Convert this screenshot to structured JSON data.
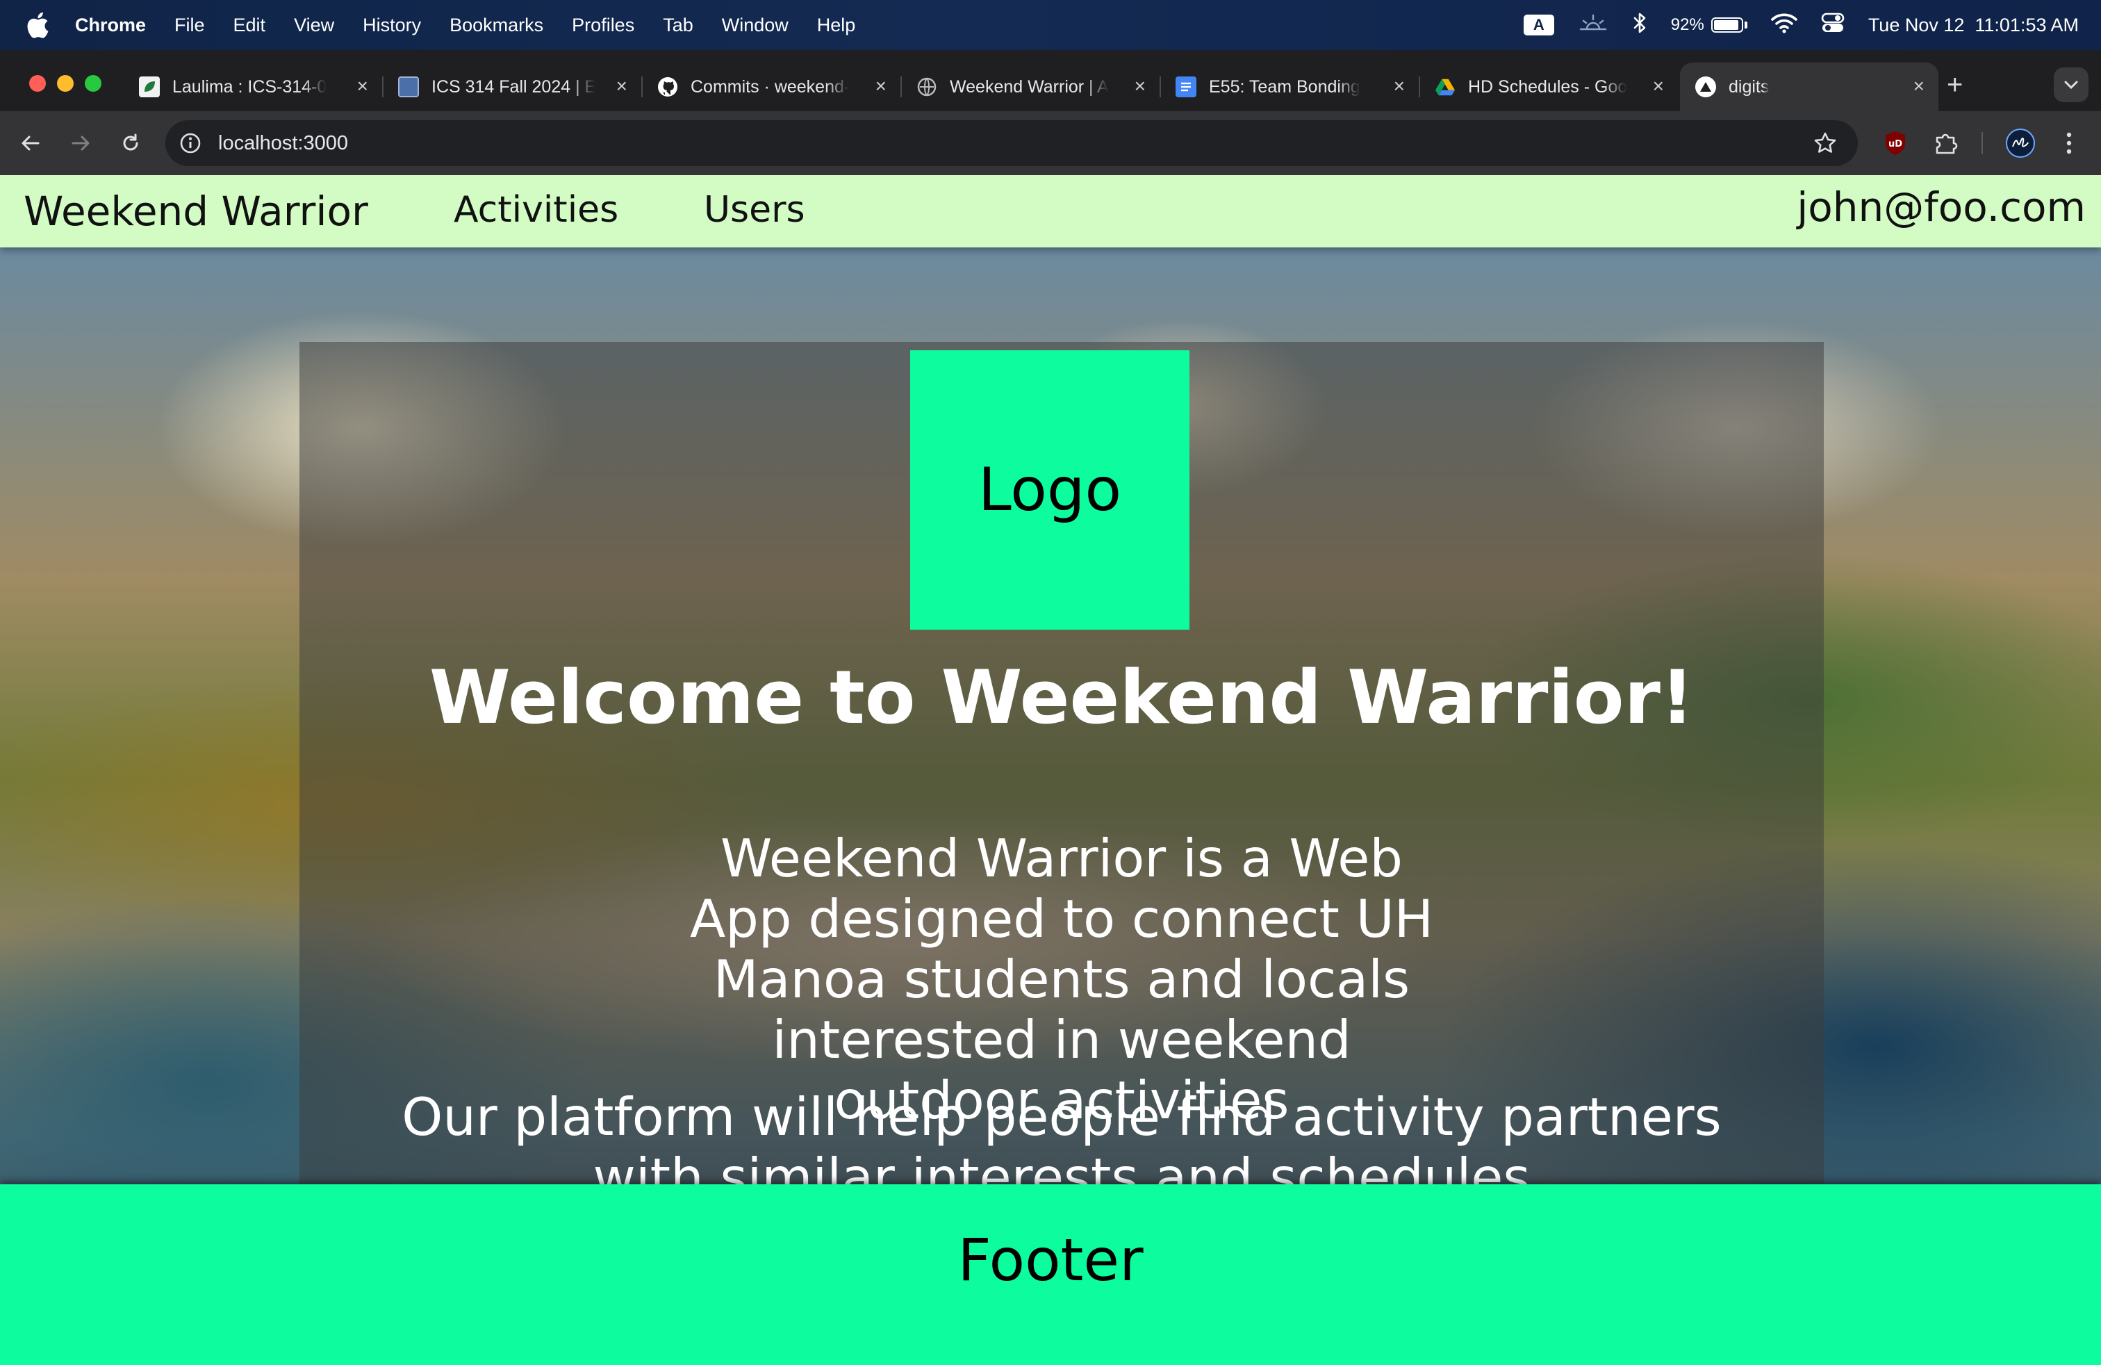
{
  "os_menubar": {
    "app": "Chrome",
    "menus": [
      "File",
      "Edit",
      "View",
      "History",
      "Bookmarks",
      "Profiles",
      "Tab",
      "Window",
      "Help"
    ],
    "input_badge": "A",
    "battery_percent": "92%",
    "battery_level": 0.92,
    "datetime": "Tue Nov 12  11:01:53 AM"
  },
  "tabs": [
    {
      "label": "Laulima : ICS-314-0",
      "icon": "laulima-icon",
      "color": "#1e7a3a"
    },
    {
      "label": "ICS 314 Fall 2024 | E",
      "icon": "ics-site-icon",
      "color": "#4b6fa8"
    },
    {
      "label": "Commits · weekend-",
      "icon": "github-icon",
      "color": "#ffffff"
    },
    {
      "label": "Weekend Warrior | A",
      "icon": "globe-icon",
      "color": "#bbbbbb"
    },
    {
      "label": "E55: Team Bonding",
      "icon": "google-docs-icon",
      "color": "#4285f4"
    },
    {
      "label": "HD Schedules - Goo",
      "icon": "google-drive-icon",
      "color": "#f4b400"
    },
    {
      "label": "digits",
      "icon": "digits-icon",
      "color": "#ffffff",
      "active": true
    }
  ],
  "browser": {
    "url": "localhost:3000"
  },
  "app_nav": {
    "brand": "Weekend Warrior",
    "links": [
      "Activities",
      "Users"
    ],
    "user": "john@foo.com"
  },
  "landing": {
    "logo": "Logo",
    "heading": "Welcome to Weekend Warrior!",
    "paragraph1": "Weekend Warrior is a Web App designed to connect UH Manoa students and locals interested in weekend outdoor activities",
    "paragraph2": "Our platform will help people find activity partners with similar interests and schedules"
  },
  "footer": {
    "text": "Footer"
  },
  "colors": {
    "navbar_bg": "#d2fcc4",
    "accent_green": "#0dfd9e"
  }
}
